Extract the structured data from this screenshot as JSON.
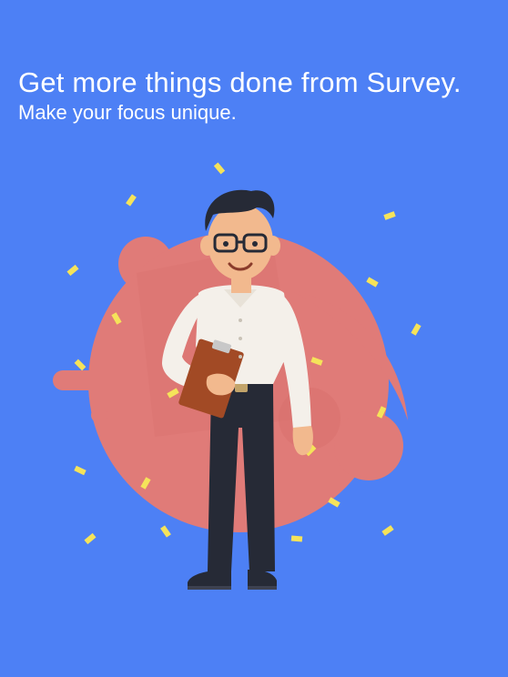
{
  "onboarding": {
    "title": "Get more things done from Survey.",
    "subtitle": "Make your focus unique."
  },
  "colors": {
    "background": "#4d80f5",
    "blob": "#e07b78",
    "confetti": "#f5e35a",
    "shirt": "#f4f0ea",
    "pants": "#262a36",
    "clipboard": "#a24a25"
  },
  "illustration": {
    "subject": "man-with-clipboard",
    "icons": [
      "blob-shape",
      "confetti-pieces",
      "man-figure",
      "clipboard-icon"
    ]
  }
}
